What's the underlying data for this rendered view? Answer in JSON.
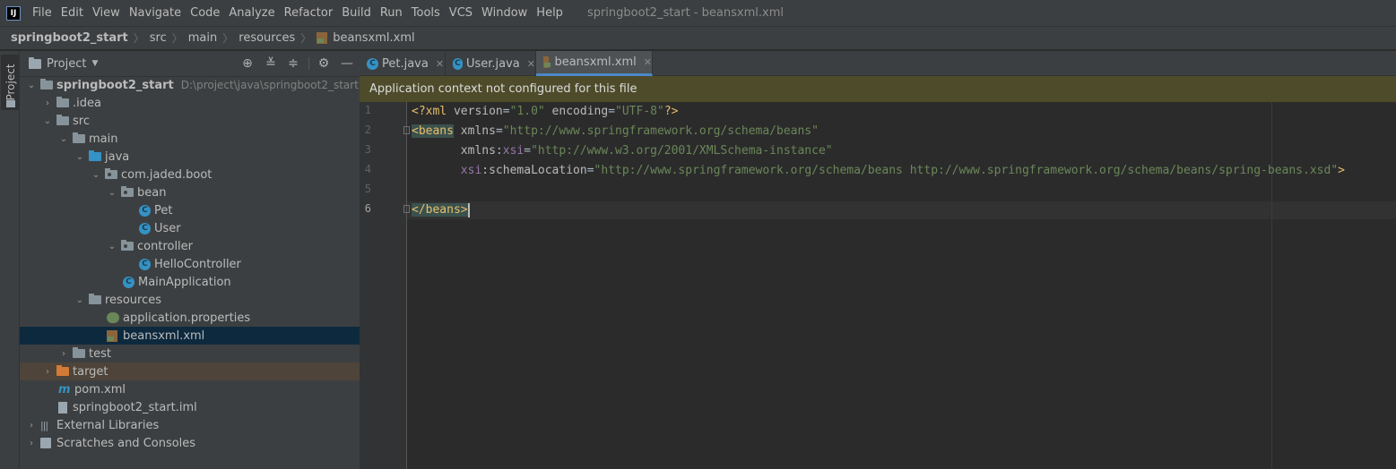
{
  "app": {
    "logo_text": "IJ",
    "window_title": "springboot2_start - beansxml.xml"
  },
  "menu": [
    "File",
    "Edit",
    "View",
    "Navigate",
    "Code",
    "Analyze",
    "Refactor",
    "Build",
    "Run",
    "Tools",
    "VCS",
    "Window",
    "Help"
  ],
  "breadcrumb": [
    "springboot2_start",
    "src",
    "main",
    "resources",
    "beansxml.xml"
  ],
  "side_stripe": {
    "label": "Project"
  },
  "project_panel": {
    "title": "Project",
    "tree": [
      {
        "label": "springboot2_start",
        "path": "D:\\project\\java\\springboot2_start"
      },
      {
        "label": ".idea"
      },
      {
        "label": "src"
      },
      {
        "label": "main"
      },
      {
        "label": "java"
      },
      {
        "label": "com.jaded.boot"
      },
      {
        "label": "bean"
      },
      {
        "label": "Pet"
      },
      {
        "label": "User"
      },
      {
        "label": "controller"
      },
      {
        "label": "HelloController"
      },
      {
        "label": "MainApplication"
      },
      {
        "label": "resources"
      },
      {
        "label": "application.properties"
      },
      {
        "label": "beansxml.xml"
      },
      {
        "label": "test"
      },
      {
        "label": "target"
      },
      {
        "label": "pom.xml"
      },
      {
        "label": "springboot2_start.iml"
      },
      {
        "label": "External Libraries"
      },
      {
        "label": "Scratches and Consoles"
      }
    ]
  },
  "editor": {
    "tabs": [
      {
        "label": "Pet.java",
        "active": false
      },
      {
        "label": "User.java",
        "active": false
      },
      {
        "label": "beansxml.xml",
        "active": true
      }
    ],
    "banner": "Application context not configured for this file",
    "line_numbers": [
      "1",
      "2",
      "3",
      "4",
      "5",
      "6"
    ],
    "code": {
      "l1": [
        "<?xml ",
        "version",
        "=",
        "\"1.0\"",
        " encoding",
        "=",
        "\"UTF-8\"",
        "?>"
      ],
      "l2": [
        "<beans",
        " xmlns",
        "=",
        "\"http://www.springframework.org/schema/beans\""
      ],
      "l3": [
        "       xmlns",
        ":",
        "xsi",
        "=",
        "\"http://www.w3.org/2001/XMLSchema-instance\""
      ],
      "l4": [
        "       ",
        "xsi",
        ":schemaLocation",
        "=",
        "\"http://www.springframework.org/schema/beans http://www.springframework.org/schema/beans/spring-beans.xsd\"",
        ">"
      ],
      "l6": [
        "</beans>"
      ]
    }
  }
}
